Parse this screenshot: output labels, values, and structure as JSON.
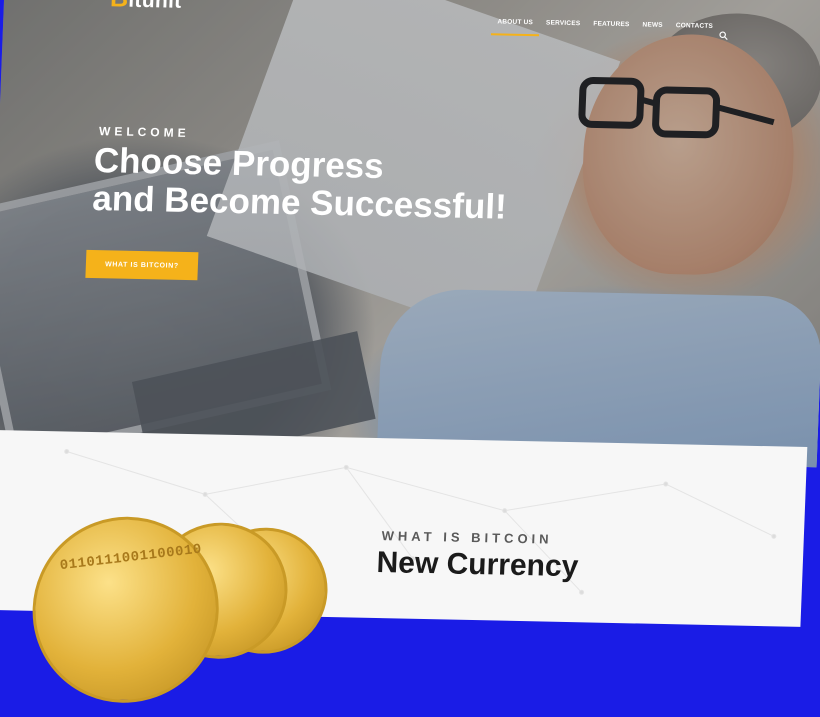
{
  "brand": {
    "initial": "B",
    "name_rest": "itunit",
    "accent_color": "#f5b21a"
  },
  "nav": {
    "items": [
      {
        "label": "ABOUT US",
        "active": true
      },
      {
        "label": "SERVICES",
        "active": false
      },
      {
        "label": "FEATURES",
        "active": false
      },
      {
        "label": "NEWS",
        "active": false
      },
      {
        "label": "CONTACTS",
        "active": false
      }
    ],
    "search_icon": "search-icon"
  },
  "hero": {
    "eyebrow": "WELCOME",
    "headline_line1": "Choose Progress",
    "headline_line2": "and Become Successful!",
    "cta_label": "WHAT IS BITCOIN?"
  },
  "about": {
    "eyebrow": "WHAT IS BITCOIN",
    "title": "New Currency",
    "coin_text": "0110111001100010"
  }
}
